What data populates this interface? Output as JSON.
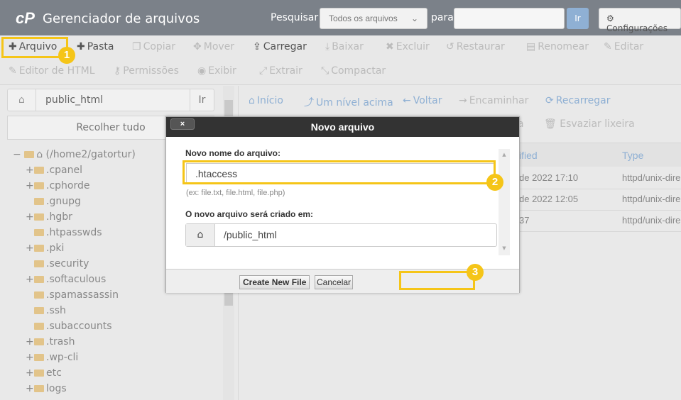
{
  "header": {
    "logo": "cP",
    "title": "Gerenciador de arquivos",
    "search_label": "Pesquisar",
    "search_scope": "Todos os arquivos",
    "for_label": "para",
    "search_value": "",
    "go": "Ir",
    "settings": "Configurações"
  },
  "toolbar": {
    "row1": [
      {
        "label": "Arquivo",
        "icon": "plus-icon",
        "on": true
      },
      {
        "label": "Pasta",
        "icon": "plus-icon",
        "on": true
      },
      {
        "label": "Copiar",
        "icon": "copy-icon"
      },
      {
        "label": "Mover",
        "icon": "move-icon"
      },
      {
        "label": "Carregar",
        "icon": "upload-icon",
        "on": true
      },
      {
        "label": "Baixar",
        "icon": "download-icon"
      },
      {
        "label": "Excluir",
        "icon": "close-icon"
      },
      {
        "label": "Restaurar",
        "icon": "undo-icon"
      },
      {
        "label": "Renomear",
        "icon": "file-icon"
      },
      {
        "label": "Editar",
        "icon": "pencil-icon"
      }
    ],
    "row2": [
      {
        "label": "Editor de HTML",
        "icon": "edit-icon"
      },
      {
        "label": "Permissões",
        "icon": "key-icon"
      },
      {
        "label": "Exibir",
        "icon": "eye-icon"
      },
      {
        "label": "Extrair",
        "icon": "expand-icon"
      },
      {
        "label": "Compactar",
        "icon": "compress-icon"
      }
    ]
  },
  "steps": [
    "1",
    "2",
    "3"
  ],
  "left": {
    "path": "public_html",
    "go": "Ir",
    "collapse": "Recolher tudo",
    "root": "(/home2/gatortur)",
    "tree": [
      {
        "name": ".cpanel",
        "plus": true
      },
      {
        "name": ".cphorde",
        "plus": true
      },
      {
        "name": ".gnupg",
        "plus": false
      },
      {
        "name": ".hgbr",
        "plus": true
      },
      {
        "name": ".htpasswds",
        "plus": false
      },
      {
        "name": ".pki",
        "plus": true
      },
      {
        "name": ".security",
        "plus": false
      },
      {
        "name": ".softaculous",
        "plus": true
      },
      {
        "name": ".spamassassin",
        "plus": false
      },
      {
        "name": ".ssh",
        "plus": false
      },
      {
        "name": ".subaccounts",
        "plus": false
      },
      {
        "name": ".trash",
        "plus": true
      },
      {
        "name": ".wp-cli",
        "plus": true
      },
      {
        "name": "etc",
        "plus": true
      },
      {
        "name": "logs",
        "plus": true
      }
    ]
  },
  "right": {
    "nav": [
      {
        "label": "Início",
        "icon": "home-icon"
      },
      {
        "label": "Um nível acima",
        "icon": "level-up-icon"
      },
      {
        "label": "Voltar",
        "icon": "arrow-left-icon"
      },
      {
        "label": "Encaminhar",
        "icon": "arrow-right-icon"
      },
      {
        "label": "Recarregar",
        "icon": "refresh-icon"
      }
    ],
    "partial": "a",
    "empty_trash": "Esvaziar lixeira",
    "col_modified": "ified",
    "col_type": "Type",
    "rows": [
      {
        "modified": "de 2022 17:10",
        "type": "httpd/unix-dire"
      },
      {
        "modified": " de 2022 12:05",
        "type": "httpd/unix-dire"
      },
      {
        "modified": "37",
        "type": "httpd/unix-dire"
      }
    ]
  },
  "dialog": {
    "title": "Novo arquivo",
    "close": "×",
    "name_label": "Novo nome do arquivo:",
    "name_value": ".htaccess",
    "hint": "(ex: file.txt, file.html, file.php)",
    "loc_label": "O novo arquivo será criado em:",
    "loc_value": "/public_html",
    "create": "Create New File",
    "cancel": "Cancelar"
  },
  "colors": {
    "highlight": "#f5c518",
    "header": "#7b8189",
    "link": "#8fb0d4"
  }
}
